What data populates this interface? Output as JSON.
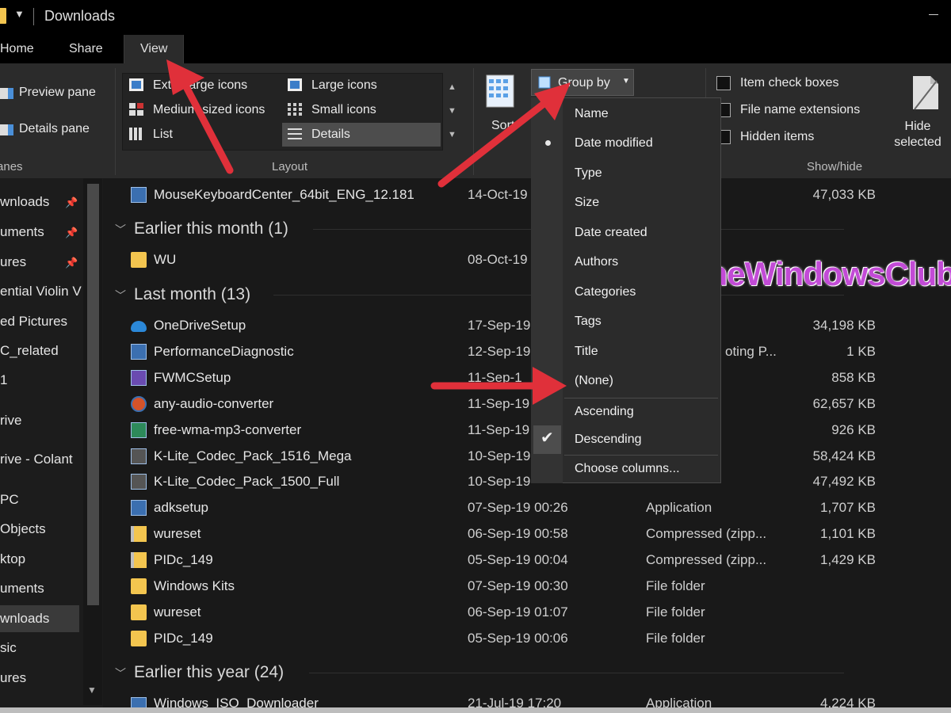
{
  "window": {
    "title": "Downloads"
  },
  "tabs": [
    "Home",
    "Share",
    "View"
  ],
  "ribbon": {
    "panes": {
      "preview": "Preview pane",
      "details": "Details pane",
      "label": "Panes"
    },
    "layout": {
      "label": "Layout",
      "extra_large": "Extra large icons",
      "large": "Large icons",
      "medium": "Medium-sized icons",
      "small": "Small icons",
      "list": "List",
      "details": "Details"
    },
    "sort": "Sort",
    "group_by": "Group by",
    "show_hide": {
      "label": "Show/hide",
      "item_check_boxes": "Item check boxes",
      "file_name_extensions": "File name extensions",
      "hidden_items": "Hidden items",
      "hide_selected": "Hide selected items"
    }
  },
  "group_by_menu": {
    "items": [
      "Name",
      "Date modified",
      "Type",
      "Size",
      "Date created",
      "Authors",
      "Categories",
      "Tags",
      "Title",
      "(None)"
    ],
    "selected": "Date modified",
    "order": [
      "Ascending",
      "Descending"
    ],
    "checked_order": "Descending",
    "choose_columns": "Choose columns..."
  },
  "sidebar": {
    "items": [
      "wnloads",
      "uments",
      "ures",
      "ential Violin V",
      "ed Pictures",
      "C_related",
      "1",
      "rive",
      "rive - Colant",
      "PC",
      "Objects",
      "ktop",
      "uments",
      "wnloads",
      "sic",
      "ures"
    ],
    "selected": "wnloads"
  },
  "groups": [
    {
      "title": "Earlier this month (1)"
    },
    {
      "title": "Last month (13)"
    },
    {
      "title": "Earlier this year (24)"
    }
  ],
  "rows": {
    "top": {
      "name": "MouseKeyboardCenter_64bit_ENG_12.181",
      "date": "14-Oct-19",
      "type": "",
      "size": "47,033 KB"
    },
    "earlier_this_month": [
      {
        "name": "WU",
        "date": "08-Oct-19",
        "type": "",
        "size": ""
      }
    ],
    "last_month": [
      {
        "name": "OneDriveSetup",
        "date": "17-Sep-19",
        "type": "",
        "size": "34,198 KB"
      },
      {
        "name": "PerformanceDiagnostic",
        "date": "12-Sep-19",
        "type": "oting P...",
        "size": "1 KB"
      },
      {
        "name": "FWMCSetup",
        "date": "11-Sep-1",
        "type": "",
        "size": "858 KB"
      },
      {
        "name": "any-audio-converter",
        "date": "11-Sep-19",
        "type": "",
        "size": "62,657 KB"
      },
      {
        "name": "free-wma-mp3-converter",
        "date": "11-Sep-19",
        "type": "",
        "size": "926 KB"
      },
      {
        "name": "K-Lite_Codec_Pack_1516_Mega",
        "date": "10-Sep-19",
        "type": "",
        "size": "58,424 KB"
      },
      {
        "name": "K-Lite_Codec_Pack_1500_Full",
        "date": "10-Sep-19",
        "type": "",
        "size": "47,492 KB"
      },
      {
        "name": "adksetup",
        "date": "07-Sep-19 00:26",
        "type": "Application",
        "size": "1,707 KB"
      },
      {
        "name": "wureset",
        "date": "06-Sep-19 00:58",
        "type": "Compressed (zipp...",
        "size": "1,101 KB"
      },
      {
        "name": "PIDc_149",
        "date": "05-Sep-19 00:04",
        "type": "Compressed (zipp...",
        "size": "1,429 KB"
      },
      {
        "name": "Windows Kits",
        "date": "07-Sep-19 00:30",
        "type": "File folder",
        "size": ""
      },
      {
        "name": "wureset",
        "date": "06-Sep-19 01:07",
        "type": "File folder",
        "size": ""
      },
      {
        "name": "PIDc_149",
        "date": "05-Sep-19 00:06",
        "type": "File folder",
        "size": ""
      }
    ],
    "partial": {
      "name": "Windows_ISO_Downloader",
      "date": "21-Jul-19 17:20",
      "type": "Application",
      "size": "4,224 KB"
    }
  },
  "watermark": "TheWindowsClub.c",
  "colors": {
    "background": "#191919",
    "ribbon": "#2b2b2b",
    "arrow": "#e0303a",
    "folder": "#f3c54f",
    "watermark": "#c24bd6"
  }
}
